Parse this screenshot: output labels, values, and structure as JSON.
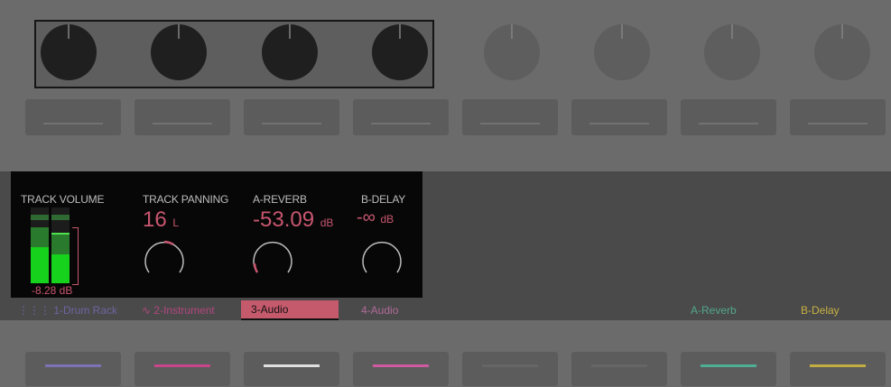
{
  "encoders": [
    {
      "name": "encoder-1"
    },
    {
      "name": "encoder-2"
    },
    {
      "name": "encoder-3"
    },
    {
      "name": "encoder-4"
    },
    {
      "name": "encoder-5"
    },
    {
      "name": "encoder-6"
    },
    {
      "name": "encoder-7"
    },
    {
      "name": "encoder-8"
    }
  ],
  "panel": {
    "track_volume": {
      "title": "TRACK VOLUME",
      "value": "-8.28 dB"
    },
    "track_panning": {
      "title": "TRACK PANNING",
      "value": "16",
      "unit": "L"
    },
    "a_reverb": {
      "title": "A-REVERB",
      "value": "-53.09",
      "unit": "dB"
    },
    "b_delay": {
      "title": "B-DELAY",
      "value": "-∞",
      "unit": "dB"
    }
  },
  "tracks": [
    {
      "label": "1-Drum Rack",
      "color": "#7d72b5"
    },
    {
      "label": "2-Instrument",
      "color": "#c9458a"
    },
    {
      "label": "3-Audio",
      "color": "#e0e0e0"
    },
    {
      "label": "4-Audio",
      "color": "#d05aa0"
    },
    {
      "label": "",
      "color": "#666666"
    },
    {
      "label": "",
      "color": "#666666"
    },
    {
      "label": "A-Reverb",
      "color": "#4fae94"
    },
    {
      "label": "B-Delay",
      "color": "#c2ad42"
    }
  ],
  "colors": {
    "accent": "#c8566f",
    "meter_green": "#17d21c",
    "selected_track": "#c55a6d"
  }
}
